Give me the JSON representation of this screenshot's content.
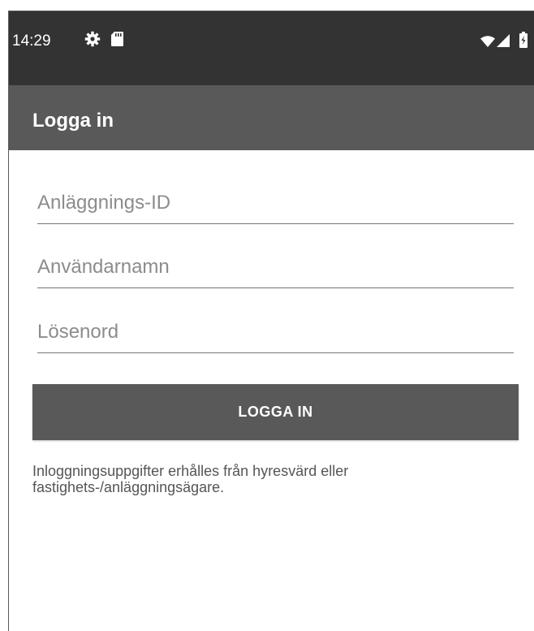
{
  "status_bar": {
    "time": "14:29",
    "icons": [
      "gear-icon",
      "sd-card-icon",
      "wifi-icon",
      "signal-icon",
      "battery-icon"
    ]
  },
  "app_bar": {
    "title": "Logga in"
  },
  "form": {
    "facility_id": {
      "placeholder": "Anläggnings-ID",
      "value": ""
    },
    "username": {
      "placeholder": "Användarnamn",
      "value": ""
    },
    "password": {
      "placeholder": "Lösenord",
      "value": ""
    },
    "login_label": "LOGGA IN"
  },
  "info": {
    "text": "Inloggningsuppgifter erhålles från hyresvärd eller fastighets-/anläggningsägare."
  },
  "colors": {
    "status_bar": "#333333",
    "app_bar": "#595959",
    "button": "#595959",
    "underline": "#757575"
  }
}
